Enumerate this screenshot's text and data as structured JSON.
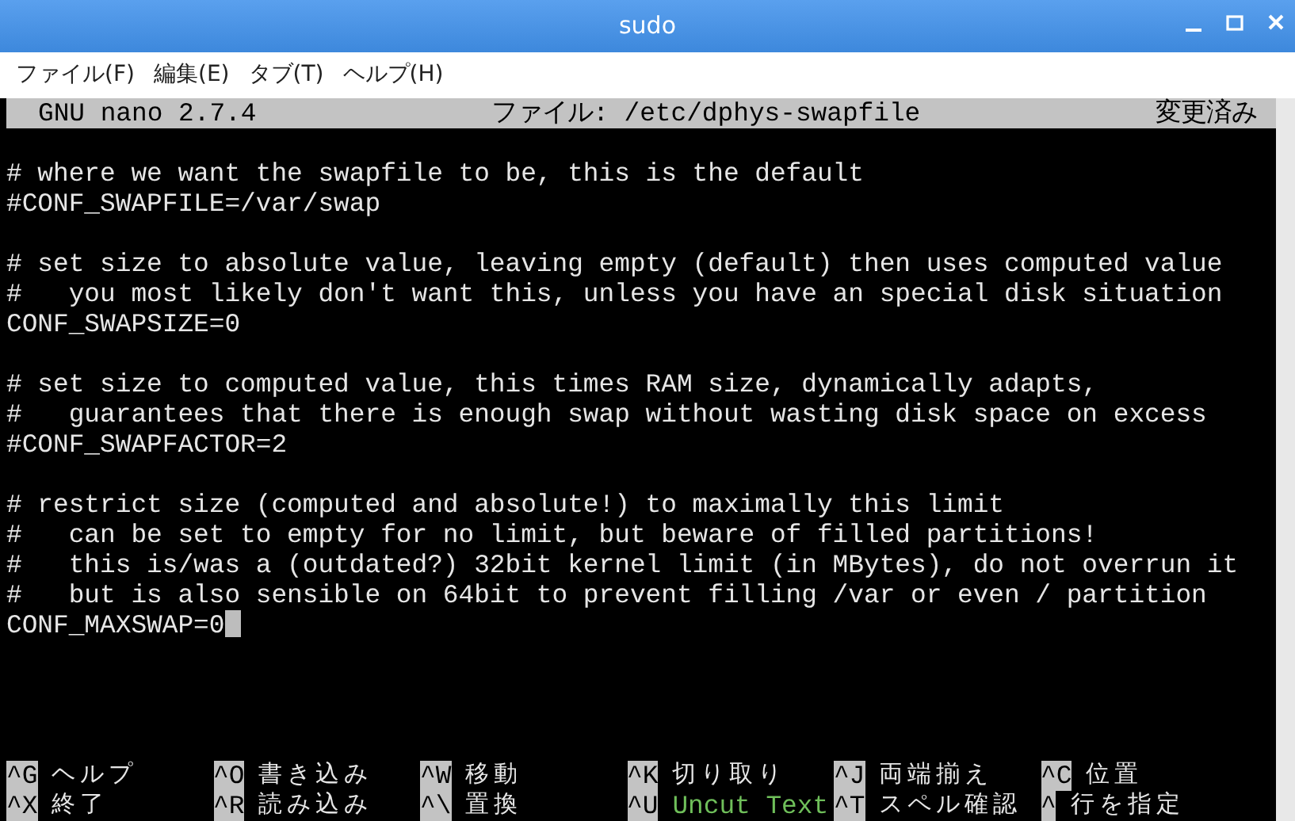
{
  "window": {
    "title": "sudo"
  },
  "menu": [
    {
      "label": "ファイル(F)"
    },
    {
      "label": "編集(E)"
    },
    {
      "label": "タブ(T)"
    },
    {
      "label": "ヘルプ(H)"
    }
  ],
  "editor": {
    "version": "GNU nano 2.7.4",
    "filename": "ファイル: /etc/dphys-swapfile",
    "status": "変更済み",
    "blocks": [
      [
        "# where we want the swapfile to be, this is the default",
        "#CONF_SWAPFILE=/var/swap"
      ],
      [
        "# set size to absolute value, leaving empty (default) then uses computed value",
        "#   you most likely don't want this, unless you have an special disk situation",
        "CONF_SWAPSIZE=0"
      ],
      [
        "# set size to computed value, this times RAM size, dynamically adapts,",
        "#   guarantees that there is enough swap without wasting disk space on excess",
        "#CONF_SWAPFACTOR=2"
      ],
      [
        "# restrict size (computed and absolute!) to maximally this limit",
        "#   can be set to empty for no limit, but beware of filled partitions!",
        "#   this is/was a (outdated?) 32bit kernel limit (in MBytes), do not overrun it",
        "#   but is also sensible on 64bit to prevent filling /var or even / partition",
        "CONF_MAXSWAP=0"
      ]
    ]
  },
  "shortcuts": [
    [
      {
        "key": "^G",
        "label": "ヘルプ",
        "disabled": false
      },
      {
        "key": "^O",
        "label": "書き込み",
        "disabled": false
      },
      {
        "key": "^W",
        "label": "移動",
        "disabled": false
      },
      {
        "key": "^K",
        "label": "切り取り",
        "disabled": false
      },
      {
        "key": "^J",
        "label": "両端揃え",
        "disabled": false
      },
      {
        "key": "^C",
        "label": "位置",
        "disabled": false
      }
    ],
    [
      {
        "key": "^X",
        "label": "終了",
        "disabled": false
      },
      {
        "key": "^R",
        "label": "読み込み",
        "disabled": false
      },
      {
        "key": "^\\",
        "label": "置換",
        "disabled": false
      },
      {
        "key": "^U",
        "label": "Uncut Text",
        "disabled": true
      },
      {
        "key": "^T",
        "label": "スペル確認",
        "disabled": false
      },
      {
        "key": "^",
        "label": "行を指定",
        "disabled": false
      }
    ]
  ]
}
